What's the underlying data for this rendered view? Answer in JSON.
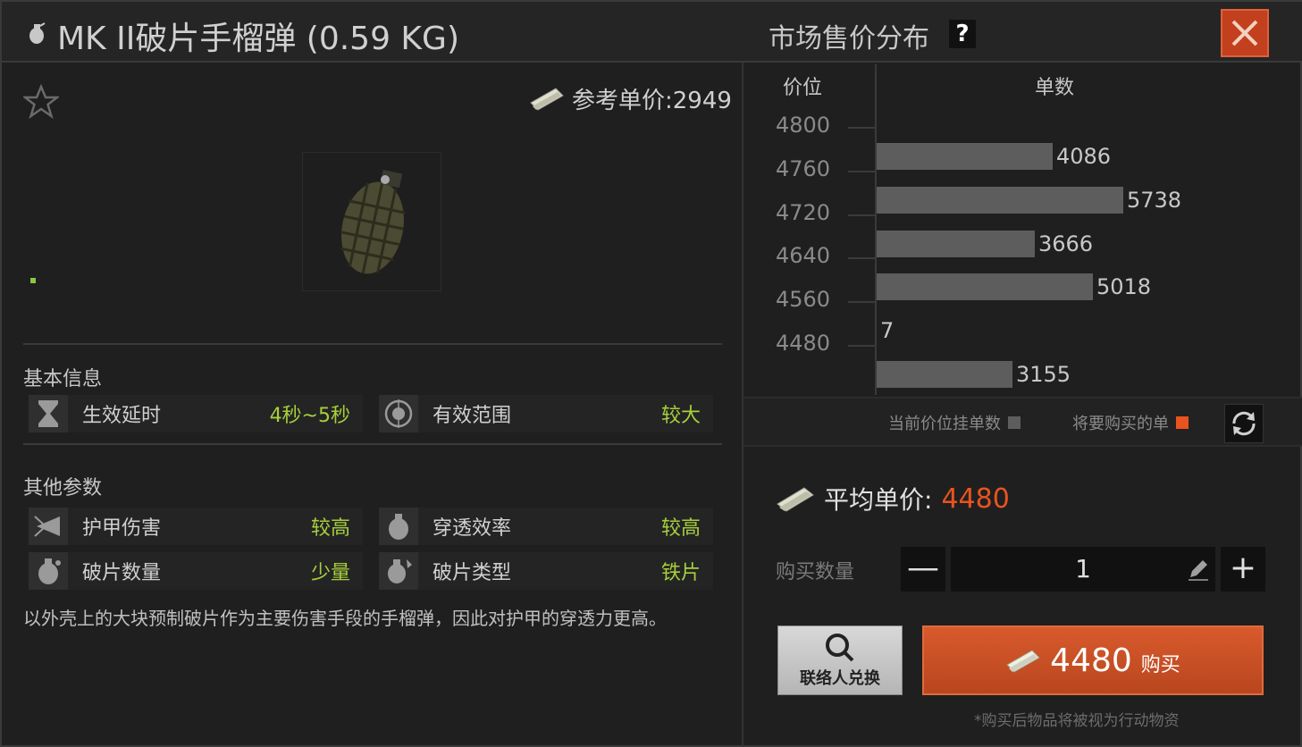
{
  "header": {
    "item_title": "MK II破片手榴弹 (0.59 KG)",
    "market_title": "市场售价分布",
    "help_label": "?"
  },
  "item": {
    "reference_price_label": "参考单价:2949",
    "icon": "grenade-image"
  },
  "basic_info": {
    "label": "基本信息",
    "stats": [
      {
        "name": "生效延时",
        "value": "4秒~5秒",
        "icon": "hourglass-icon"
      },
      {
        "name": "有效范围",
        "value": "较大",
        "icon": "range-icon"
      }
    ]
  },
  "other_params": {
    "label": "其他参数",
    "stats": [
      {
        "name": "护甲伤害",
        "value": "较高",
        "icon": "armor-damage-icon"
      },
      {
        "name": "穿透效率",
        "value": "较高",
        "icon": "penetration-icon"
      },
      {
        "name": "破片数量",
        "value": "少量",
        "icon": "fragment-count-icon"
      },
      {
        "name": "破片类型",
        "value": "铁片",
        "icon": "fragment-type-icon"
      }
    ]
  },
  "description": "以外壳上的大块预制破片作为主要伤害手段的手榴弹，因此对护甲的穿透力更高。",
  "chart_data": {
    "type": "bar",
    "orientation": "horizontal",
    "xlabel": "单数",
    "ylabel": "价位",
    "y_ticks": [
      "4800",
      "4760",
      "4720",
      "4640",
      "4560",
      "4480"
    ],
    "values": [
      4086,
      5738,
      3666,
      5018,
      7,
      3155
    ],
    "x_max": 9800
  },
  "legend": {
    "current_orders": "当前价位挂单数",
    "to_buy": "将要购买的单",
    "current_color": "#5d5d5d",
    "to_buy_color": "#e9531f"
  },
  "purchase": {
    "avg_label": "平均单价:",
    "avg_value": "4480",
    "qty_label": "购买数量",
    "qty_value": "1",
    "minus_label": "—",
    "plus_label": "+",
    "contact_label": "联络人兑换",
    "buy_price": "4480",
    "buy_word": "购买",
    "note": "*购买后物品将被视为行动物资"
  },
  "colors": {
    "accent": "#e9531f",
    "good": "#a7cf3c"
  }
}
